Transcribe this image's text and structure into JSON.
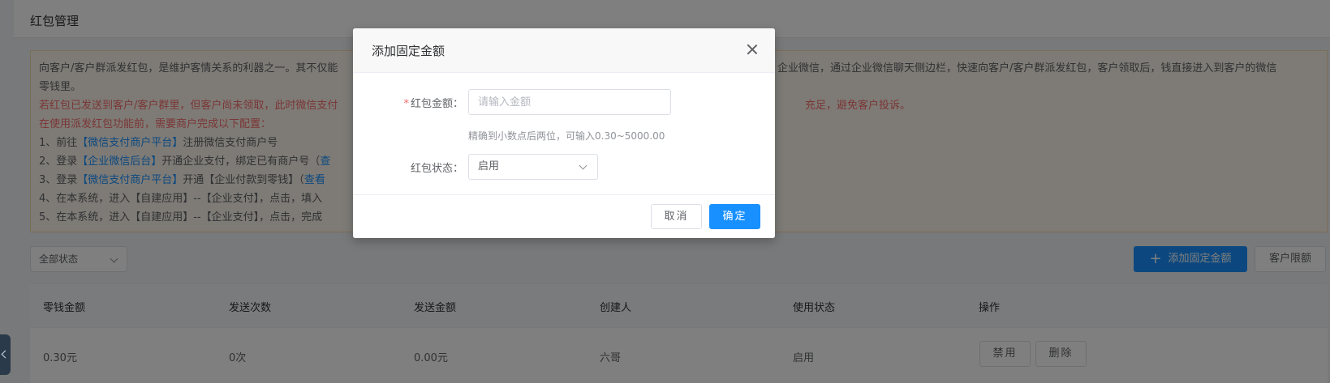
{
  "page": {
    "title": "红包管理"
  },
  "notice": {
    "line1": "向客户/客户群派发红包，是维护客情关系的利器之一。其不仅能",
    "line1_right": "企业微信，通过企业微信聊天侧边栏，快速向客户/客户群派发红包，客户领取后，钱直接进入到客户的微信",
    "line2": "零钱里。",
    "line3_red": "若红包已发送到客户/客户群里，但客户尚未领取，此时微信支付",
    "line3_red_right": "充足，避免客户投诉。",
    "line4_red": "在使用派发红包功能前，需要商户完成以下配置：",
    "step1_prefix": "1、前往",
    "step1_link": "【微信支付商户平台】",
    "step1_suffix": "注册微信支付商户号",
    "step2_prefix": "2、登录",
    "step2_link": "【企业微信后台】",
    "step2_suffix": "开通企业支付，绑定已有商户号（",
    "step2_link2": "查",
    "step3_prefix": "3、登录",
    "step3_link": "【微信支付商户平台】",
    "step3_suffix": "开通【企业付款到零钱】（",
    "step3_link2": "查看",
    "step4": "4、在本系统，进入【自建应用】--【企业支付】，点击，填入",
    "step5": "5、在本系统，进入【自建应用】--【企业支付】，点击，完成"
  },
  "toolbar": {
    "status_filter": "全部状态",
    "add_button": "添加固定金额",
    "limit_button": "客户限额"
  },
  "table": {
    "headers": [
      "零钱金额",
      "发送次数",
      "发送金额",
      "创建人",
      "使用状态",
      "操作"
    ],
    "rows": [
      {
        "amount": "0.30元",
        "send_count": "0次",
        "send_amount": "0.00元",
        "creator": "六哥",
        "status": "启用",
        "disable_label": "禁用",
        "delete_label": "删除"
      }
    ]
  },
  "modal": {
    "title": "添加固定金额",
    "amount_label": "红包金额：",
    "amount_required_mark": "*",
    "amount_placeholder": "请输入金额",
    "amount_value": "",
    "hint": "精确到小数点后两位，可输入0.30~5000.00",
    "status_label": "红包状态：",
    "status_value": "启用",
    "cancel_label": "取消",
    "ok_label": "确定"
  },
  "colors": {
    "primary": "#1890ff",
    "danger": "#f56c6c",
    "notice_bg": "#fdf6ec"
  },
  "icons": {
    "close": "close-icon",
    "plus": "plus-icon",
    "chevron": "chevron-down-icon",
    "sidebar_toggle": "chevron-left-icon"
  }
}
